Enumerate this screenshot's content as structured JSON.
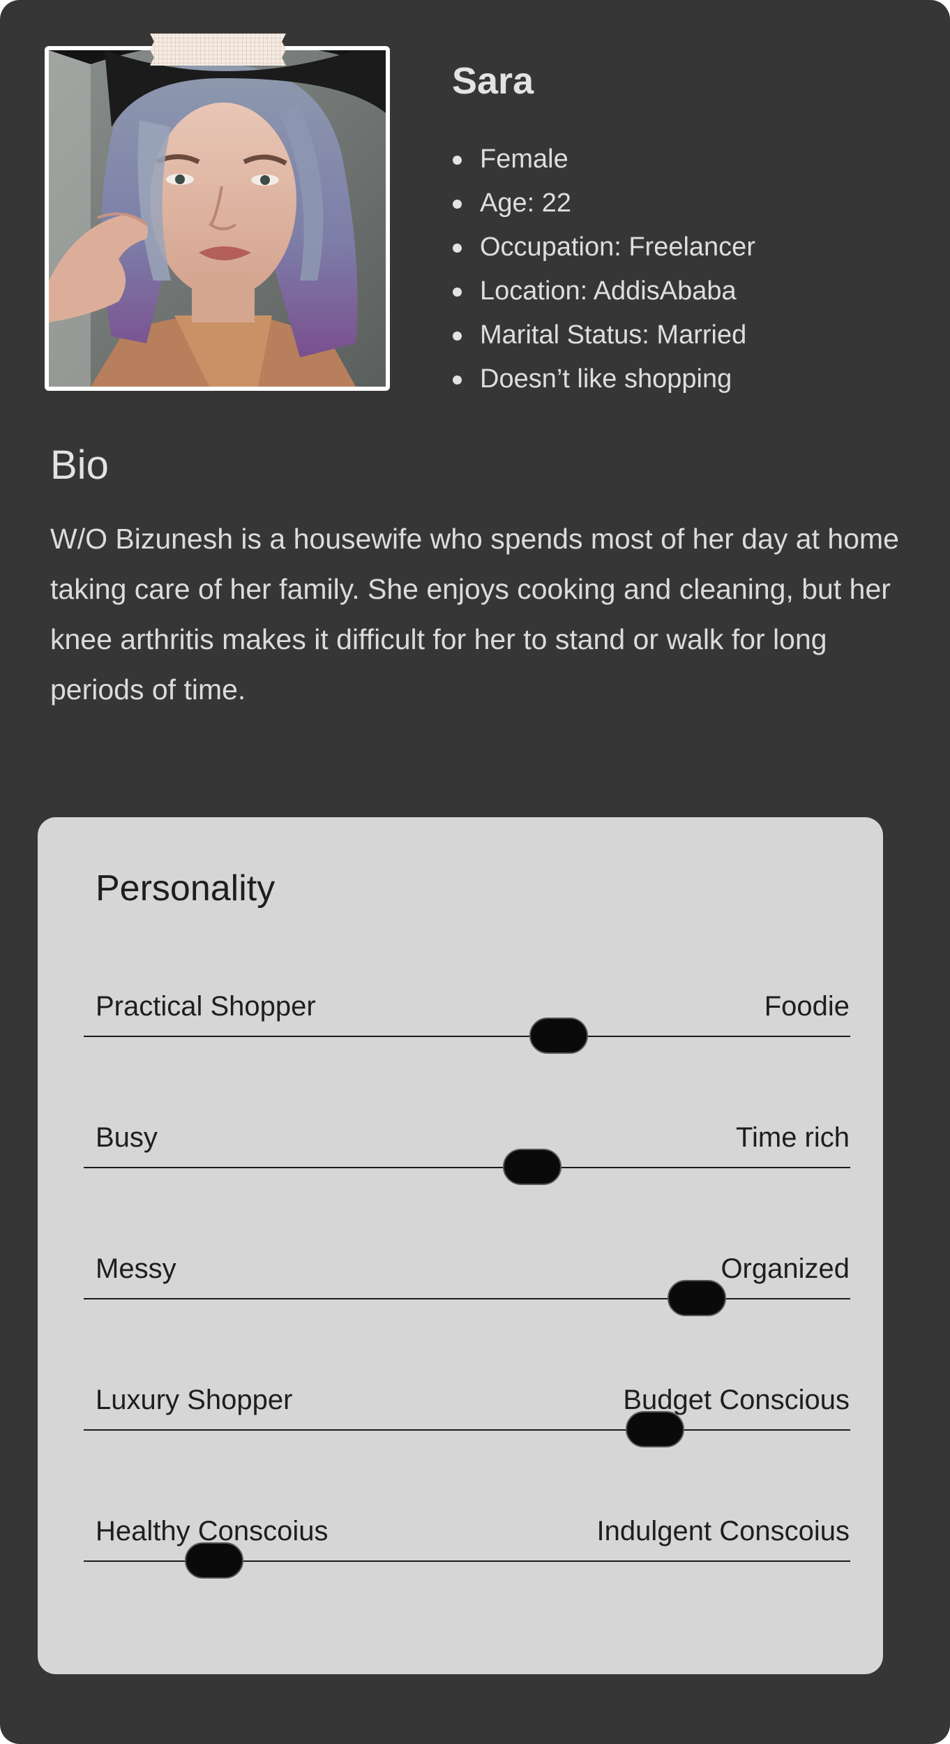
{
  "persona": {
    "name": "Sara",
    "facts": [
      "Female",
      "Age: 22",
      "Occupation: Freelancer",
      "Location: AddisAbaba",
      "Marital Status: Married",
      "Doesn’t like shopping"
    ]
  },
  "bio": {
    "title": "Bio",
    "text": "W/O Bizunesh is a housewife who spends most of her day at home taking care of her family. She enjoys cooking and cleaning, but her knee arthritis makes it difficult for her to stand or walk for long periods of time."
  },
  "personality": {
    "title": "Personality",
    "traits": [
      {
        "left": "Practical Shopper",
        "right": "Foodie",
        "value": 0.62
      },
      {
        "left": "Busy",
        "right": "Time rich",
        "value": 0.585
      },
      {
        "left": "Messy",
        "right": "Organized",
        "value": 0.8
      },
      {
        "left": "Luxury Shopper",
        "right": "Budget Conscious",
        "value": 0.745
      },
      {
        "left": "Healthy Conscoius",
        "right": "Indulgent Conscoius",
        "value": 0.17
      }
    ]
  },
  "colors": {
    "card_background": "#363636",
    "panel_background": "#d6d6d6",
    "knob": "#0a0a0a"
  }
}
